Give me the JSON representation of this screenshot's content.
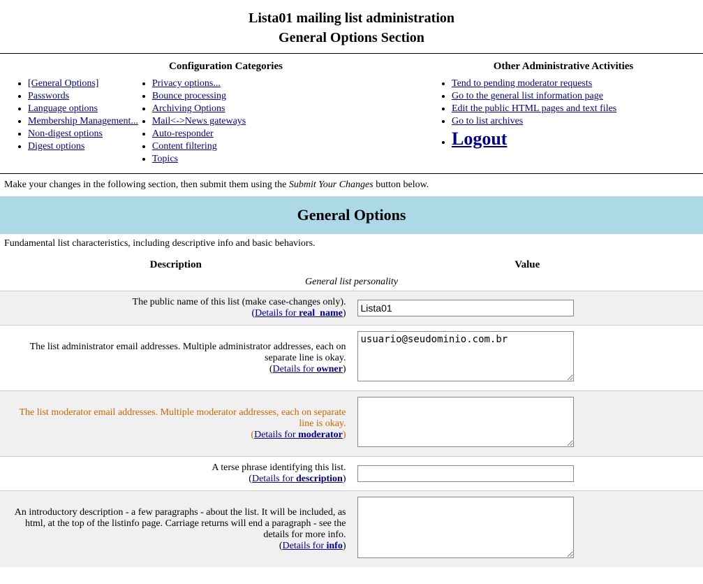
{
  "page": {
    "title_line1": "Lista01 mailing list administration",
    "title_line2": "General Options Section"
  },
  "config_categories": {
    "heading": "Configuration Categories",
    "col1": [
      {
        "label": "[General Options]",
        "href": "#"
      },
      {
        "label": "Passwords",
        "href": "#"
      },
      {
        "label": "Language options",
        "href": "#"
      },
      {
        "label": "Membership Management...",
        "href": "#"
      },
      {
        "label": "Non-digest options",
        "href": "#"
      },
      {
        "label": "Digest options",
        "href": "#"
      }
    ],
    "col2": [
      {
        "label": "Privacy options...",
        "href": "#"
      },
      {
        "label": "Bounce processing",
        "href": "#"
      },
      {
        "label": "Archiving Options",
        "href": "#"
      },
      {
        "label": "Mail<->News gateways",
        "href": "#"
      },
      {
        "label": "Auto-responder",
        "href": "#"
      },
      {
        "label": "Content filtering",
        "href": "#"
      },
      {
        "label": "Topics",
        "href": "#"
      }
    ]
  },
  "other_admin": {
    "heading": "Other Administrative Activities",
    "items": [
      {
        "label": "Tend to pending moderator requests",
        "href": "#"
      },
      {
        "label": "Go to the general list information page",
        "href": "#"
      },
      {
        "label": "Edit the public HTML pages and text files",
        "href": "#"
      },
      {
        "label": "Go to list archives",
        "href": "#"
      }
    ],
    "logout_label": "Logout"
  },
  "intro_text": "Make your changes in the following section, then submit them using the",
  "intro_italic": "Submit Your Changes",
  "intro_text2": "button below.",
  "section_header": "General Options",
  "section_desc": "Fundamental list characteristics, including descriptive info and basic behaviors.",
  "table": {
    "col_desc": "Description",
    "col_val": "Value",
    "personality_label": "General list personality",
    "rows": [
      {
        "id": "row-public-name",
        "desc_text": "The public name of this list (make case-changes only).",
        "desc_link_text": "Details for ",
        "desc_link_bold": "real_name",
        "input_type": "text",
        "input_value": "Lista01",
        "input_name": "real_name",
        "bg": "alt"
      },
      {
        "id": "row-admin-email",
        "desc_text": "The list administrator email addresses. Multiple administrator addresses, each on separate line is okay.",
        "desc_link_text": "Details for ",
        "desc_link_bold": "owner",
        "input_type": "textarea",
        "input_value": "usuario@seudominio.com.br",
        "input_name": "owner",
        "textarea_rows": 4,
        "bg": ""
      },
      {
        "id": "row-moderator-email",
        "desc_text": "The list moderator email addresses. Multiple moderator addresses, each on separate line is okay.",
        "desc_link_text": "Details for ",
        "desc_link_bold": "moderator",
        "input_type": "textarea",
        "input_value": "",
        "input_name": "moderator",
        "textarea_rows": 4,
        "bg": "alt",
        "orange": true
      },
      {
        "id": "row-description",
        "desc_text": "A terse phrase identifying this list.",
        "desc_link_text": "Details for ",
        "desc_link_bold": "description",
        "input_type": "text",
        "input_value": "",
        "input_name": "description",
        "bg": ""
      },
      {
        "id": "row-info",
        "desc_text": "An introductory description - a few paragraphs - about the list. It will be included, as html, at the top of the listinfo page. Carriage returns will end a paragraph - see the details for more info.",
        "desc_link_text": "Details for ",
        "desc_link_bold": "info",
        "input_type": "textarea",
        "input_value": "",
        "input_name": "info",
        "textarea_rows": 5,
        "bg": "alt"
      }
    ]
  }
}
